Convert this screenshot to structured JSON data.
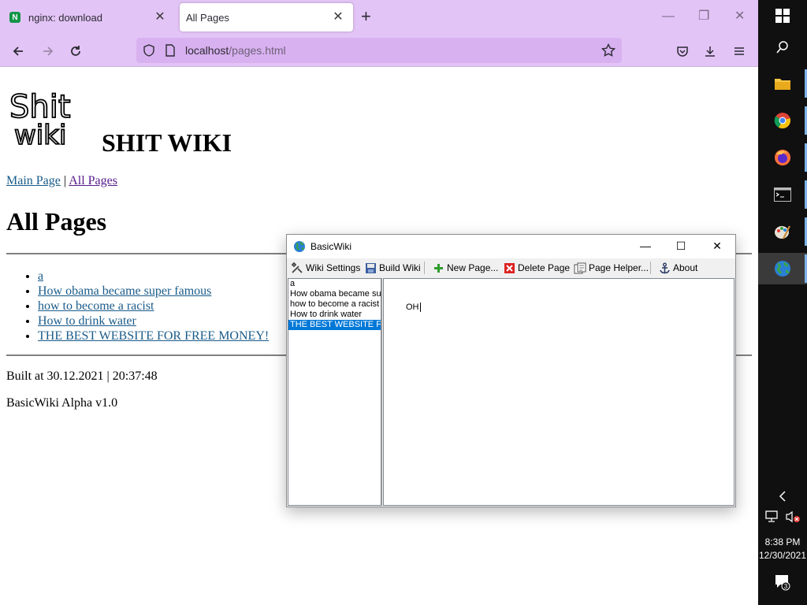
{
  "browser": {
    "tabs": [
      {
        "title": "nginx: download",
        "favicon": "nginx-icon",
        "favicon_letter": "N",
        "active": false
      },
      {
        "title": "All Pages",
        "active": true
      }
    ],
    "url": {
      "host": "localhost",
      "path": "/pages.html"
    },
    "chrome_color": "#e3c4f6"
  },
  "page": {
    "logo_alt": "Shit wiki handwritten logo",
    "logo_lines": [
      "Shit",
      "wiki"
    ],
    "site_title": "SHIT WIKI",
    "nav": {
      "main_page": "Main Page",
      "separator": "|",
      "all_pages": "All Pages"
    },
    "heading": "All Pages",
    "pages": [
      "a",
      "How obama became super famous",
      "how to become a racist",
      "How to drink water",
      "THE BEST WEBSITE FOR FREE MONEY!"
    ],
    "built_at": "Built at 30.12.2021 | 20:37:48",
    "version": "BasicWiki Alpha v1.0",
    "link_color": "#1a5b8a"
  },
  "basicwiki": {
    "title": "BasicWiki",
    "toolbar": {
      "wiki_settings": "Wiki Settings",
      "build_wiki": "Build Wiki",
      "new_page": "New Page...",
      "delete_page": "Delete Page",
      "page_helper": "Page Helper...",
      "about": "About"
    },
    "list_items": [
      "a",
      "How obama became sup",
      "how to become a racist",
      "How to drink water",
      "THE BEST WEBSITE F"
    ],
    "selected_index": 4,
    "editor_text": "OH",
    "selection_color": "#0078d7"
  },
  "taskbar": {
    "time": "8:38 PM",
    "date": "12/30/2021",
    "notification_count": "3",
    "icons": [
      "start-icon",
      "search-icon",
      "file-explorer-icon",
      "chrome-icon",
      "firefox-icon",
      "terminal-icon",
      "paint-icon",
      "basicwiki-globe-icon"
    ]
  }
}
